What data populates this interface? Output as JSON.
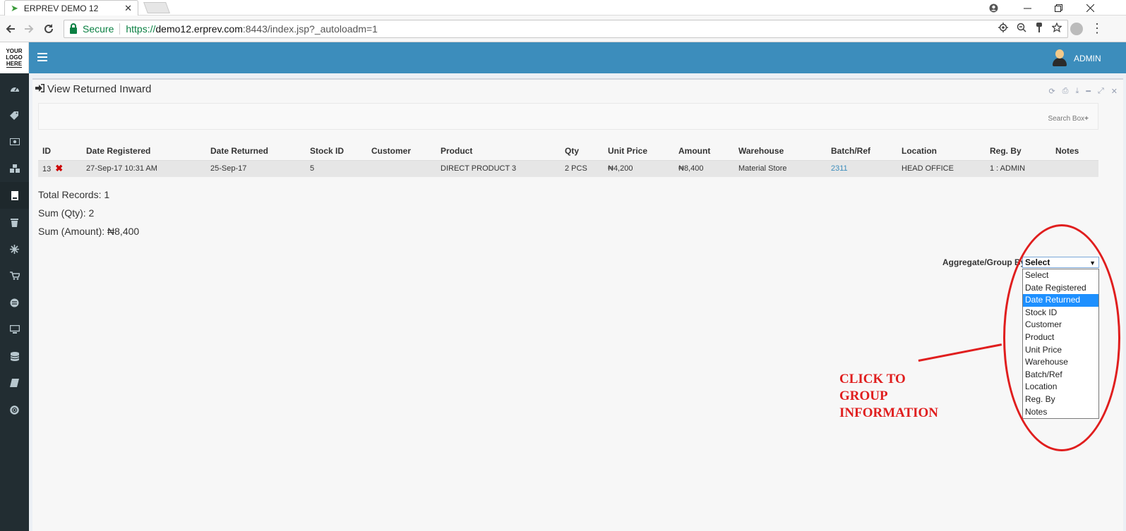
{
  "browser": {
    "tab_title": "ERPREV DEMO 12",
    "tab_close": "✕",
    "secure_label": "Secure",
    "url_scheme": "https://",
    "url_host": "demo12.erprev.com",
    "url_rest": ":8443/index.jsp?_autoloadm=1"
  },
  "sidebar": {
    "logo_lines": [
      "YOUR",
      "LOGO",
      "HERE"
    ]
  },
  "header": {
    "user_label": "ADMIN"
  },
  "panel": {
    "title": "View Returned Inward",
    "search_label": "Search Box"
  },
  "table": {
    "columns": [
      "ID",
      "Date Registered",
      "Date Returned",
      "Stock ID",
      "Customer",
      "Product",
      "Qty",
      "Unit Price",
      "Amount",
      "Warehouse",
      "Batch/Ref",
      "Location",
      "Reg. By",
      "Notes"
    ],
    "rows": [
      {
        "id": "13",
        "date_registered": "27-Sep-17 10:31 AM",
        "date_returned": "25-Sep-17",
        "stock_id": "5",
        "customer": "",
        "product": "DIRECT PRODUCT 3",
        "qty": "2 PCS",
        "unit_price": "₦4,200",
        "amount": "₦8,400",
        "warehouse": "Material Store",
        "batch_ref": "2311",
        "location": "HEAD OFFICE",
        "reg_by": "1 : ADMIN",
        "notes": ""
      }
    ]
  },
  "summary": {
    "total_records": "Total Records: 1",
    "sum_qty": "Sum (Qty): 2",
    "sum_amount": "Sum (Amount): ₦8,400"
  },
  "aggregate": {
    "label": "Aggregate/Group By:",
    "selected": "Select",
    "options": [
      "Select",
      "Date Registered",
      "Date Returned",
      "Stock ID",
      "Customer",
      "Product",
      "Unit Price",
      "Warehouse",
      "Batch/Ref",
      "Location",
      "Reg. By",
      "Notes"
    ],
    "highlighted": "Date Returned"
  },
  "annotation": {
    "lines": [
      "CLICK TO",
      "GROUP",
      "INFORMATION"
    ],
    "color": "#e01e1e"
  },
  "colors": {
    "header": "#3c8dbc",
    "sidebar": "#222d32",
    "secure_green": "#0b8043",
    "highlight": "#1e90ff"
  }
}
